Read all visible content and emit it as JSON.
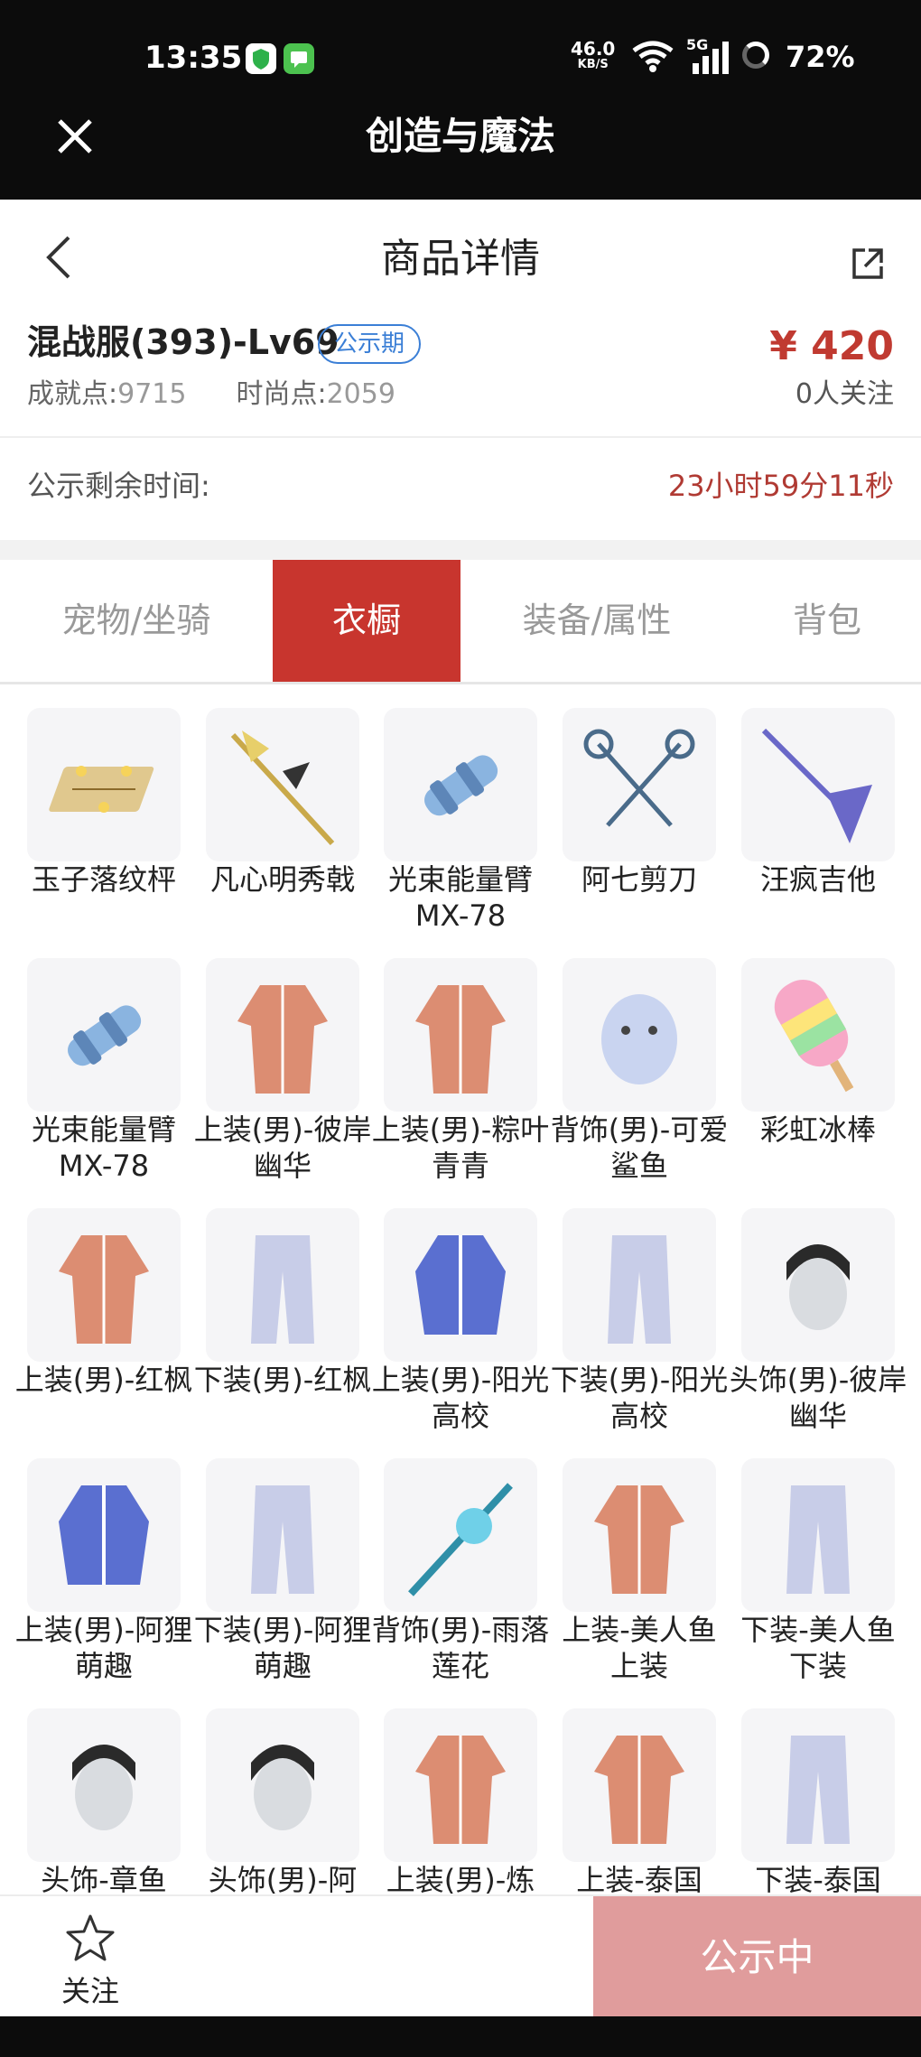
{
  "status_bar": {
    "time": "13:35",
    "net_speed": "46.0",
    "net_unit": "KB/S",
    "network": "5G",
    "battery": "72%"
  },
  "titlebar": {
    "title": "创造与魔法"
  },
  "header": {
    "title": "商品详情"
  },
  "product": {
    "name": "混战服(393)-Lv69",
    "badge": "公示期",
    "price": "¥ 420",
    "achievement_label": "成就点:",
    "achievement_value": "9715",
    "fashion_label": "时尚点:",
    "fashion_value": "2059",
    "followers": "0人关注"
  },
  "countdown": {
    "label": "公示剩余时间:",
    "value": "23小时59分11秒"
  },
  "tabs": [
    "宠物/坐骑",
    "衣橱",
    "装备/属性",
    "背包"
  ],
  "active_tab": "衣橱",
  "items": [
    {
      "name": "玉子落纹枰",
      "icon": "go-board-icon"
    },
    {
      "name": "凡心明秀戟",
      "icon": "halberd-icon"
    },
    {
      "name": "光束能量臂MX-78",
      "icon": "energy-arm-icon"
    },
    {
      "name": "阿七剪刀",
      "icon": "scissors-icon"
    },
    {
      "name": "汪疯吉他",
      "icon": "guitar-icon"
    },
    {
      "name": "光束能量臂MX-78",
      "icon": "energy-arm-icon"
    },
    {
      "name": "上装(男)-彼岸幽华",
      "icon": "robe-icon"
    },
    {
      "name": "上装(男)-粽叶青青",
      "icon": "robe-icon"
    },
    {
      "name": "背饰(男)-可爱鲨鱼",
      "icon": "shark-icon"
    },
    {
      "name": "彩虹冰棒",
      "icon": "popsicle-icon"
    },
    {
      "name": "上装(男)-红枫",
      "icon": "robe-icon"
    },
    {
      "name": "下装(男)-红枫",
      "icon": "pants-icon"
    },
    {
      "name": "上装(男)-阳光高校",
      "icon": "jacket-icon"
    },
    {
      "name": "下装(男)-阳光高校",
      "icon": "pants-icon"
    },
    {
      "name": "头饰(男)-彼岸幽华",
      "icon": "head-icon"
    },
    {
      "name": "上装(男)-阿狸萌趣",
      "icon": "jacket-icon"
    },
    {
      "name": "下装(男)-阿狸萌趣",
      "icon": "pants-icon"
    },
    {
      "name": "背饰(男)-雨落莲花",
      "icon": "lotus-staff-icon"
    },
    {
      "name": "上装-美人鱼上装",
      "icon": "robe-icon"
    },
    {
      "name": "下装-美人鱼下装",
      "icon": "pants-icon"
    },
    {
      "name": "头饰-章鱼",
      "icon": "head-icon"
    },
    {
      "name": "头饰(男)-阿",
      "icon": "head-icon"
    },
    {
      "name": "上装(男)-炼",
      "icon": "robe-icon"
    },
    {
      "name": "上装-泰国",
      "icon": "robe-icon"
    },
    {
      "name": "下装-泰国",
      "icon": "pants-icon"
    }
  ],
  "bottom": {
    "follow_label": "关注",
    "status_button": "公示中"
  },
  "colors": {
    "accent": "#c8352e",
    "price": "#c03a31",
    "badge": "#3b7fd6",
    "disabled_button": "#e09c9c"
  }
}
